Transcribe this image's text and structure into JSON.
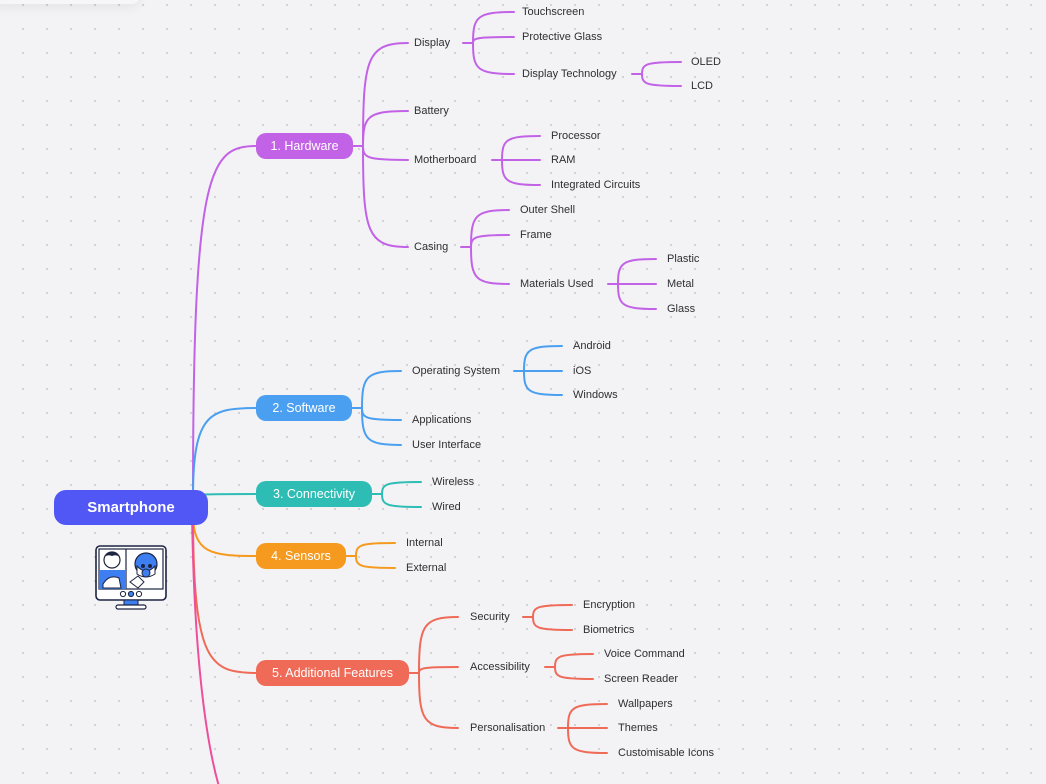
{
  "root": {
    "label": "Smartphone",
    "color": "#5157f5"
  },
  "branches": [
    {
      "label": "1. Hardware",
      "color": "#c262e6",
      "children": [
        {
          "label": "Display",
          "children": [
            {
              "label": "Touchscreen"
            },
            {
              "label": "Protective Glass"
            },
            {
              "label": "Display Technology",
              "children": [
                {
                  "label": "OLED"
                },
                {
                  "label": "LCD"
                }
              ]
            }
          ]
        },
        {
          "label": "Battery"
        },
        {
          "label": "Motherboard",
          "children": [
            {
              "label": "Processor"
            },
            {
              "label": "RAM"
            },
            {
              "label": "Integrated Circuits"
            }
          ]
        },
        {
          "label": "Casing",
          "children": [
            {
              "label": "Outer Shell"
            },
            {
              "label": "Frame"
            },
            {
              "label": "Materials Used",
              "children": [
                {
                  "label": "Plastic"
                },
                {
                  "label": "Metal"
                },
                {
                  "label": "Glass"
                }
              ]
            }
          ]
        }
      ]
    },
    {
      "label": "2. Software",
      "color": "#4a9ff0",
      "children": [
        {
          "label": "Operating System",
          "children": [
            {
              "label": "Android"
            },
            {
              "label": "iOS"
            },
            {
              "label": "Windows"
            }
          ]
        },
        {
          "label": "Applications"
        },
        {
          "label": "User Interface"
        }
      ]
    },
    {
      "label": "3. Connectivity",
      "color": "#2ebdb4",
      "children": [
        {
          "label": "Wireless"
        },
        {
          "label": "Wired"
        }
      ]
    },
    {
      "label": "4. Sensors",
      "color": "#f59a1e",
      "children": [
        {
          "label": "Internal"
        },
        {
          "label": "External"
        }
      ]
    },
    {
      "label": "5. Additional Features",
      "color": "#f06a58",
      "children": [
        {
          "label": "Security",
          "children": [
            {
              "label": "Encryption"
            },
            {
              "label": "Biometrics"
            }
          ]
        },
        {
          "label": "Accessibility",
          "children": [
            {
              "label": "Voice Command"
            },
            {
              "label": "Screen Reader"
            }
          ]
        },
        {
          "label": "Personalisation",
          "children": [
            {
              "label": "Wallpapers"
            },
            {
              "label": "Themes"
            },
            {
              "label": "Customisable Icons"
            }
          ]
        }
      ]
    },
    {
      "label": "",
      "color": "#ee4f9a",
      "offscreen": true
    }
  ],
  "illustration": {
    "icon": "video-call-monitor-icon",
    "accent": "#3d7ef0"
  }
}
